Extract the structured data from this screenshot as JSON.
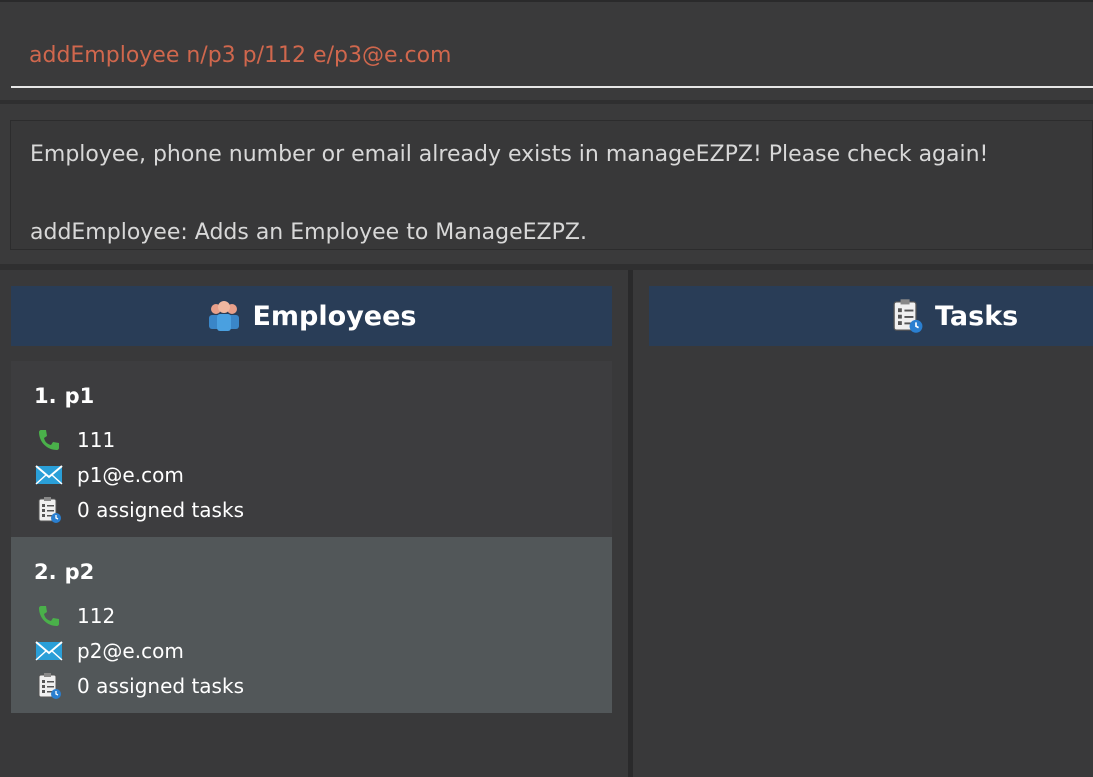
{
  "command": {
    "value": "addEmployee n/p3 p/112 e/p3@e.com",
    "text_color": "#d0674d"
  },
  "result": {
    "lines": [
      "Employee, phone number or email already exists in manageEZPZ! Please check again!",
      "addEmployee: Adds an Employee to ManageEZPZ."
    ]
  },
  "employees_panel": {
    "title": "Employees",
    "icon": "employees-icon",
    "cards": [
      {
        "index": "1.",
        "name": "p1",
        "phone": "111",
        "email": "p1@e.com",
        "tasks": "0 assigned tasks"
      },
      {
        "index": "2.",
        "name": "p2",
        "phone": "112",
        "email": "p2@e.com",
        "tasks": "0 assigned tasks"
      }
    ]
  },
  "tasks_panel": {
    "title": "Tasks",
    "icon": "tasks-clipboard-icon"
  },
  "colors": {
    "header_bg": "#293d57",
    "selected_card_bg": "#525759",
    "phone_icon": "#4ab04a",
    "mail_icon": "#2a9fd8"
  }
}
